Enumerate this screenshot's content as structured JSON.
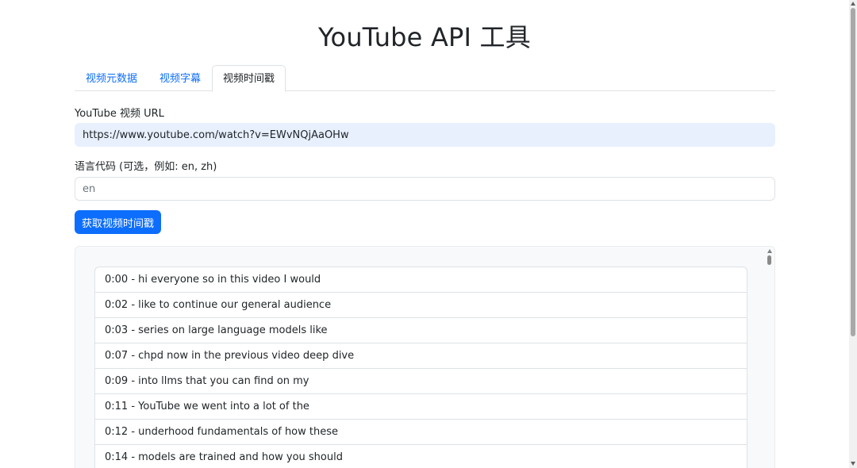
{
  "header": {
    "title": "YouTube API 工具"
  },
  "tabs": [
    {
      "label": "视频元数据",
      "active": false
    },
    {
      "label": "视频字幕",
      "active": false
    },
    {
      "label": "视频时间戳",
      "active": true
    }
  ],
  "form": {
    "url_label": "YouTube 视频 URL",
    "url_value": "https://www.youtube.com/watch?v=EWvNQjAaOHw",
    "lang_label": "语言代码 (可选，例如: en, zh)",
    "lang_placeholder": "en",
    "lang_value": "",
    "submit_label": "获取视频时间戳"
  },
  "timestamps": [
    "0:00 - hi everyone so in this video I would",
    "0:02 - like to continue our general audience",
    "0:03 - series on large language models like",
    "0:07 - chpd now in the previous video deep dive",
    "0:09 - into llms that you can find on my",
    "0:11 - YouTube we went into a lot of the",
    "0:12 - underhood fundamentals of how these",
    "0:14 - models are trained and how you should"
  ],
  "colors": {
    "accent": "#0d6efd",
    "url_field_bg": "#e8f0fe",
    "results_bg": "#f8f9fa"
  }
}
